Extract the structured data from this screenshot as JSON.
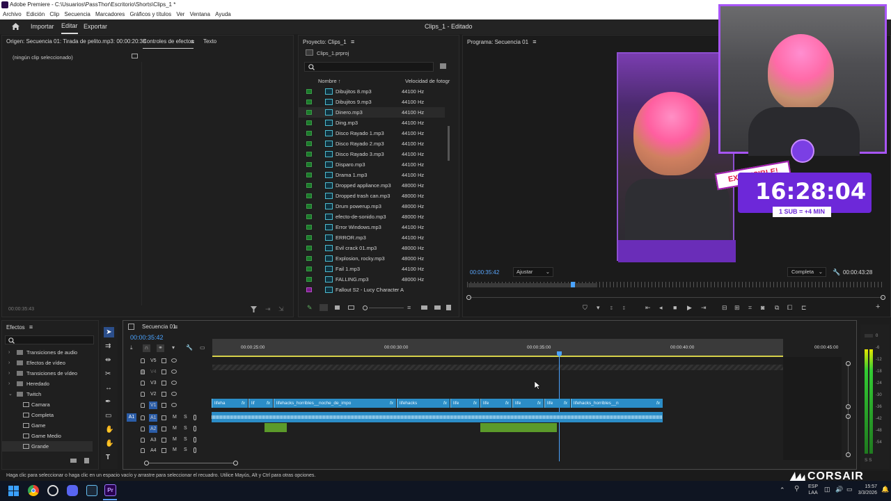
{
  "window": {
    "title": "Adobe Premiere - C:\\Usuarios\\PassThor\\Escritorio\\Shorts\\Clips_1 *"
  },
  "menu": [
    "Archivo",
    "Edición",
    "Clip",
    "Secuencia",
    "Marcadores",
    "Gráficos y títulos",
    "Ver",
    "Ventana",
    "Ayuda"
  ],
  "workspace": {
    "tabs": [
      "Importar",
      "Editar",
      "Exportar"
    ],
    "active_tab": "Editar",
    "project_title": "Clips_1 - Editado"
  },
  "source_panel": {
    "origin_tab": "Origen: Secuencia 01: Tirada de pelito.mp3: 00:00:20:38",
    "effects_controls_tab": "Controles de efectos",
    "text_tab": "Texto",
    "no_clip": "(ningún clip seleccionado)",
    "timecode": "00:00:35:43"
  },
  "project_panel": {
    "tab": "Proyecto: Clips_1",
    "file": "Clips_1.prproj",
    "col_name": "Nombre",
    "col_rate": "Velocidad de fotogr",
    "items": [
      {
        "name": "Dibujitos 8.mp3",
        "rate": "44100 Hz"
      },
      {
        "name": "Dibujitos 9.mp3",
        "rate": "44100 Hz"
      },
      {
        "name": "Dinero.mp3",
        "rate": "44100 Hz"
      },
      {
        "name": "Ding.mp3",
        "rate": "44100 Hz"
      },
      {
        "name": "Disco Rayado 1.mp3",
        "rate": "44100 Hz"
      },
      {
        "name": "Disco Rayado 2.mp3",
        "rate": "44100 Hz"
      },
      {
        "name": "Disco Rayado 3.mp3",
        "rate": "44100 Hz"
      },
      {
        "name": "Disparo.mp3",
        "rate": "44100 Hz"
      },
      {
        "name": "Drama 1.mp3",
        "rate": "44100 Hz"
      },
      {
        "name": "Dropped appliance.mp3",
        "rate": "48000 Hz"
      },
      {
        "name": "Dropped trash can.mp3",
        "rate": "48000 Hz"
      },
      {
        "name": "Drum powerup.mp3",
        "rate": "48000 Hz"
      },
      {
        "name": "efecto-de-sonido.mp3",
        "rate": "48000 Hz"
      },
      {
        "name": "Error Windows.mp3",
        "rate": "44100 Hz"
      },
      {
        "name": "ERROR.mp3",
        "rate": "44100 Hz"
      },
      {
        "name": "Evil crack 01.mp3",
        "rate": "48000 Hz"
      },
      {
        "name": "Explosion, rocky.mp3",
        "rate": "48000 Hz"
      },
      {
        "name": "Fail 1.mp3",
        "rate": "44100 Hz"
      },
      {
        "name": "FALLING.mp3",
        "rate": "48000 Hz"
      },
      {
        "name": "Fallout S2 - Lucy Character A",
        "rate": ""
      }
    ]
  },
  "program_panel": {
    "tab": "Programa: Secuencia 01",
    "timecode": "00:00:35:42",
    "fit": "Ajustar",
    "quality": "Completa",
    "duration": "00:00:43:28"
  },
  "effects_panel": {
    "tab": "Efectos",
    "tree": [
      {
        "label": "Transiciones de audio",
        "level": 0
      },
      {
        "label": "Efectos de vídeo",
        "level": 0
      },
      {
        "label": "Transiciones de vídeo",
        "level": 0
      },
      {
        "label": "Heredado",
        "level": 0
      },
      {
        "label": "Twitch",
        "level": 0
      },
      {
        "label": "Camara",
        "level": 1
      },
      {
        "label": "Completa",
        "level": 1
      },
      {
        "label": "Game",
        "level": 1
      },
      {
        "label": "Game Medio",
        "level": 1
      },
      {
        "label": "Grande",
        "level": 1
      }
    ]
  },
  "timeline": {
    "tab": "Secuencia 01",
    "timecode": "00:00:35:42",
    "ruler": [
      "00:00:25:00",
      "00:00:30:00",
      "00:00:35:00",
      "00:00:40:00",
      "00:00:45:00"
    ],
    "video_tracks": [
      "V5",
      "V4",
      "V3",
      "V2",
      "V1"
    ],
    "audio_tracks": [
      "A1",
      "A2",
      "A3",
      "A4"
    ],
    "source_patch_v": "V1",
    "source_patch_a": "A1",
    "clips": [
      {
        "label": "lifeha",
        "fx": "fx"
      },
      {
        "label": "lif",
        "fx": "fx"
      },
      {
        "label": "lifehacks_horribles__noche_de_impo",
        "fx": "fx"
      },
      {
        "label": "lifehacks",
        "fx": "fx"
      },
      {
        "label": "life",
        "fx": "fx"
      },
      {
        "label": "life",
        "fx": "fx"
      },
      {
        "label": "life",
        "fx": "fx"
      },
      {
        "label": "life",
        "fx": "fx"
      },
      {
        "label": "lifehacks_horribles__n",
        "fx": "fx"
      }
    ],
    "meter_scale": [
      "0",
      "-6",
      "-12",
      "-18",
      "-24",
      "-30",
      "-36",
      "-42",
      "-48",
      "-54"
    ],
    "meter_footer": "S S"
  },
  "status_bar": "Haga clic para seleccionar o haga clic en un espacio vacío y arrastre para seleccionar el recuadro. Utilice Mayús, Alt y Ctrl para otras opciones.",
  "stream_overlay": {
    "badge": "EXTENSIBLE!",
    "timer": "16:28:04",
    "sub_rate": "1 SUB = +4 MIN",
    "brand": "CORSAIR"
  },
  "taskbar": {
    "lang": "ESP",
    "region": "LAA",
    "time": "15:57",
    "date": "3/3/2026"
  }
}
